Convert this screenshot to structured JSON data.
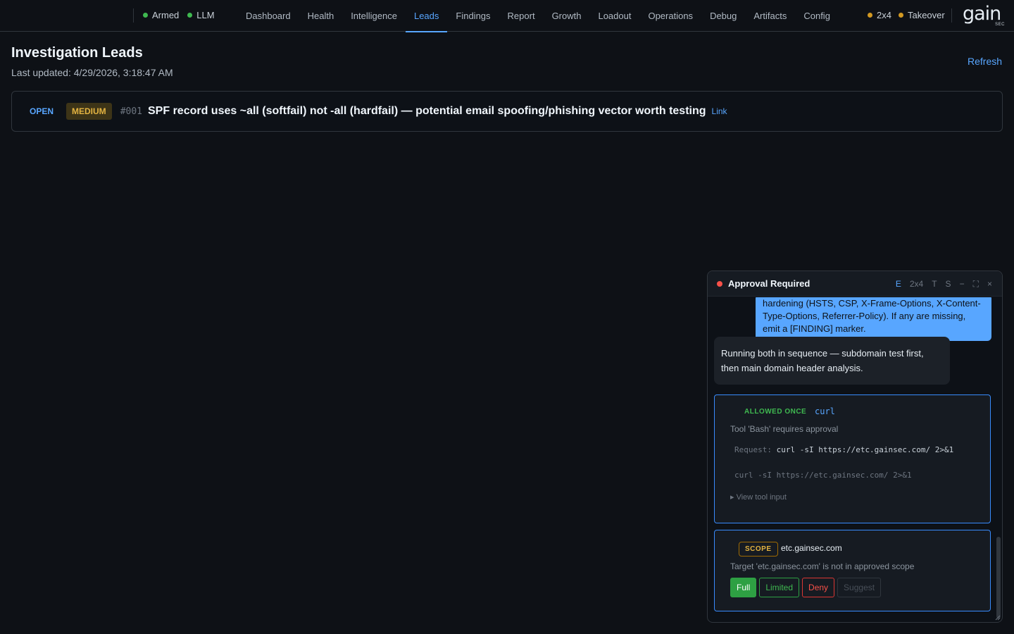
{
  "topbar": {
    "status": [
      {
        "label": "Armed",
        "color": "#3fb950"
      },
      {
        "label": "LLM",
        "color": "#3fb950"
      }
    ],
    "tabs": [
      {
        "label": "Dashboard",
        "active": false
      },
      {
        "label": "Health",
        "active": false
      },
      {
        "label": "Intelligence",
        "active": false
      },
      {
        "label": "Leads",
        "active": true
      },
      {
        "label": "Findings",
        "active": false
      },
      {
        "label": "Report",
        "active": false
      },
      {
        "label": "Growth",
        "active": false
      },
      {
        "label": "Loadout",
        "active": false
      },
      {
        "label": "Operations",
        "active": false
      },
      {
        "label": "Debug",
        "active": false
      },
      {
        "label": "Artifacts",
        "active": false
      },
      {
        "label": "Config",
        "active": false
      }
    ],
    "right_status": [
      {
        "label": "2x4",
        "color": "#d29922"
      },
      {
        "label": "Takeover",
        "color": "#d29922"
      }
    ],
    "logo": {
      "word": "gain",
      "sub": "SEC"
    }
  },
  "page": {
    "title": "Investigation Leads",
    "updated": "Last updated: 4/29/2026, 3:18:47 AM",
    "refresh": "Refresh"
  },
  "leads": [
    {
      "status": "OPEN",
      "severity": "MEDIUM",
      "id": "#001",
      "title": "SPF record uses ~all (softfail) not -all (hardfail) — potential email spoofing/phishing vector worth testing",
      "link": "Link"
    }
  ],
  "approval": {
    "title": "Approval Required",
    "controls": {
      "e": "E",
      "session": "2x4",
      "t": "T",
      "s": "S",
      "min": "−",
      "max": "⛶",
      "close": "×"
    },
    "user_message": "hardening (HSTS, CSP, X-Frame-Options, X-Content-Type-Options, Referrer-Policy). If any are missing, emit a [FINDING] marker.",
    "assistant_message": "Running both in sequence — subdomain test first, then main domain header analysis.",
    "tool_card": {
      "status": "ALLOWED ONCE",
      "command": "curl",
      "description": "Tool 'Bash' requires approval",
      "request_label": "Request:",
      "request_value": "curl -sI https://etc.gainsec.com/ 2>&1",
      "command_preview": "curl -sI https://etc.gainsec.com/ 2>&1",
      "view_input": "▸ View tool input"
    },
    "scope_card": {
      "chip": "SCOPE",
      "domain": "etc.gainsec.com",
      "description": "Target 'etc.gainsec.com' is not in approved scope",
      "buttons": {
        "full": "Full",
        "limited": "Limited",
        "deny": "Deny",
        "suggest": "Suggest"
      }
    }
  }
}
